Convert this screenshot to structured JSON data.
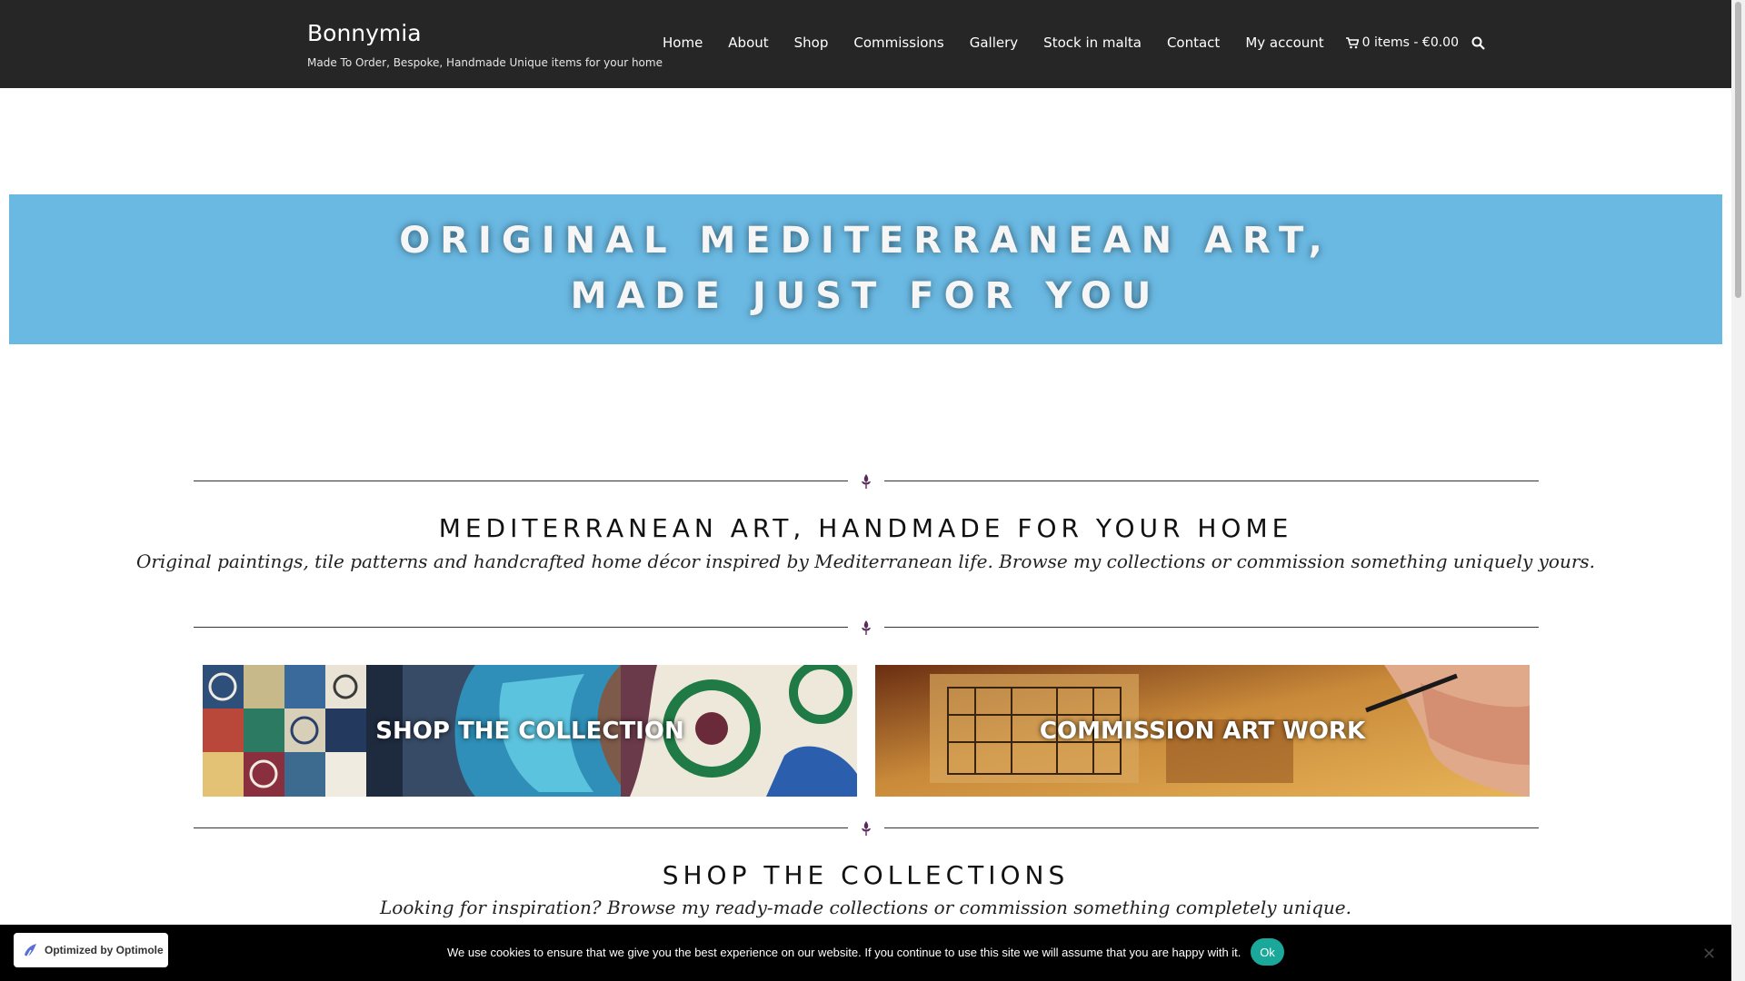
{
  "site": {
    "title": "Bonnymia",
    "tagline": "Made To Order, Bespoke, Handmade Unique items for your home"
  },
  "nav": {
    "items": [
      {
        "label": "Home"
      },
      {
        "label": "About"
      },
      {
        "label": "Shop"
      },
      {
        "label": "Commissions"
      },
      {
        "label": "Gallery"
      },
      {
        "label": "Stock in malta"
      },
      {
        "label": "Contact"
      },
      {
        "label": "My account"
      }
    ],
    "cart_label": "0 items - €0.00",
    "cart_icon": "cart-icon",
    "search_icon": "search-icon"
  },
  "hero": {
    "line1": "ORIGINAL MEDITERRANEAN ART,",
    "line2": "MADE JUST FOR YOU",
    "background": "#6ab9e3"
  },
  "intro": {
    "title": "MEDITERRANEAN ART, HANDMADE FOR YOUR HOME",
    "subtitle": "Original paintings, tile patterns and handcrafted home décor inspired by Mediterranean life. Browse my collections or commission something uniquely yours."
  },
  "cards": {
    "shop_label": "SHOP THE COLLECTION",
    "commission_label": "COMMISSION ART WORK"
  },
  "collections": {
    "title": "SHOP THE COLLECTIONS",
    "subtitle": "Looking for inspiration? Browse my ready-made collections or commission something completely unique."
  },
  "cookie": {
    "text": "We use cookies to ensure that we give you the best experience on our website. If you continue to use this site we will assume that you are happy with it.",
    "ok_label": "Ok",
    "close_glyph": "✕"
  },
  "badge": {
    "text": "Optimized by Optimole"
  },
  "colors": {
    "header": "#262626",
    "accent_ornament": "#5a2a5a",
    "cookie_ok": "#1aa89a"
  }
}
